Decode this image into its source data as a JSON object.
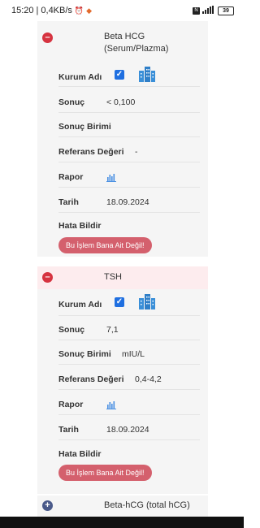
{
  "status_bar": {
    "time": "15:20",
    "network_speed": "0,4KB/s",
    "battery": "39"
  },
  "tests": [
    {
      "name_line1": "Beta HCG",
      "name_line2": "(Serum/Plazma)",
      "fields": {
        "kurum_adi_label": "Kurum Adı",
        "sonuc_label": "Sonuç",
        "sonuc_value": "< 0,100",
        "sonuc_birimi_label": "Sonuç Birimi",
        "sonuc_birimi_value": "",
        "referans_label": "Referans Değeri",
        "referans_value": "-",
        "rapor_label": "Rapor",
        "tarih_label": "Tarih",
        "tarih_value": "18.09.2024",
        "hata_label": "Hata Bildir",
        "hata_button": "Bu İşlem Bana Ait Değil!"
      }
    },
    {
      "name_line1": "TSH",
      "fields": {
        "kurum_adi_label": "Kurum Adı",
        "sonuc_label": "Sonuç",
        "sonuc_value": "7,1",
        "sonuc_birimi_label": "Sonuç Birimi",
        "sonuc_birimi_value": "mIU/L",
        "referans_label": "Referans Değeri",
        "referans_value": "0,4-4,2",
        "rapor_label": "Rapor",
        "tarih_label": "Tarih",
        "tarih_value": "18.09.2024",
        "hata_label": "Hata Bildir",
        "hata_button": "Bu İşlem Bana Ait Değil!"
      }
    },
    {
      "name_line1": "Beta-hCG (total hCG)"
    }
  ],
  "colors": {
    "minus_toggle": "#d63340",
    "plus_toggle": "#4a5a8a",
    "checkbox": "#1f6fe0",
    "report_button": "#d4606d",
    "selected_header": "#fdecee",
    "building_icon": "#3a8fd8",
    "chart_icon": "#4a90e2"
  },
  "icons": [
    "minus-circle-icon",
    "checkbox-checked-icon",
    "building-icon",
    "bar-chart-icon",
    "plus-circle-icon"
  ]
}
